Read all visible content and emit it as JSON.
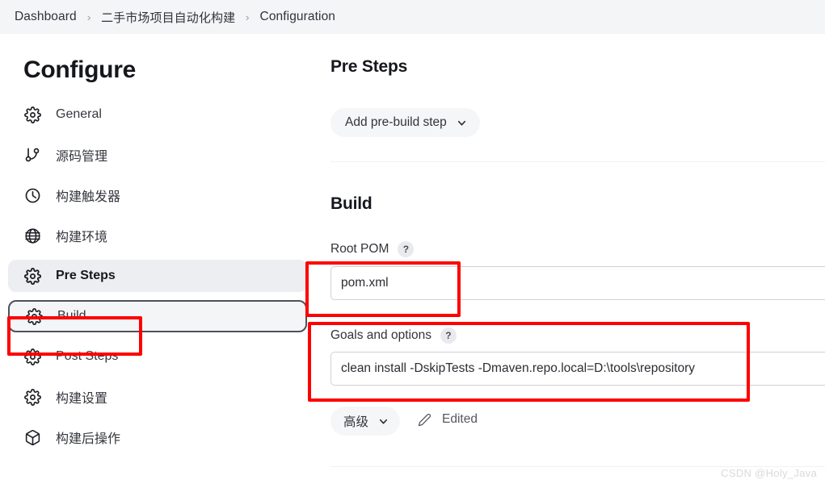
{
  "breadcrumb": {
    "separator": "›",
    "items": [
      {
        "label": "Dashboard",
        "lang": "en"
      },
      {
        "label": "二手市场项目自动化构建",
        "lang": "cn"
      },
      {
        "label": "Configuration",
        "lang": "en"
      }
    ]
  },
  "sidebar": {
    "title": "Configure",
    "items": [
      {
        "label": "General",
        "icon": "gear-icon",
        "state": "normal"
      },
      {
        "label": "源码管理",
        "icon": "git-branch-icon",
        "state": "normal"
      },
      {
        "label": "构建触发器",
        "icon": "clock-icon",
        "state": "normal"
      },
      {
        "label": "构建环境",
        "icon": "globe-icon",
        "state": "normal"
      },
      {
        "label": "Pre Steps",
        "icon": "gear-icon",
        "state": "active"
      },
      {
        "label": "Build",
        "icon": "gear-icon",
        "state": "focused"
      },
      {
        "label": "Post Steps",
        "icon": "gear-icon",
        "state": "normal"
      },
      {
        "label": "构建设置",
        "icon": "gear-icon",
        "state": "normal"
      },
      {
        "label": "构建后操作",
        "icon": "package-icon",
        "state": "normal"
      }
    ]
  },
  "main": {
    "pre_steps": {
      "title": "Pre Steps",
      "add_button_label": "Add pre-build step",
      "add_button_icon": "chevron-down-icon"
    },
    "build": {
      "title": "Build",
      "root_pom": {
        "label": "Root POM",
        "help": "?",
        "value": "pom.xml",
        "placeholder": ""
      },
      "goals": {
        "label": "Goals and options",
        "help": "?",
        "value": "clean install -DskipTests -Dmaven.repo.local=D:\\tools\\repository",
        "placeholder": ""
      },
      "advanced": {
        "label": "高级",
        "icon": "chevron-down-icon"
      },
      "edited": {
        "label": "Edited",
        "icon": "pencil-icon"
      }
    }
  },
  "annotations": {
    "color": "#fe0000",
    "boxes": [
      {
        "target": "sidebar-item-build"
      },
      {
        "target": "root-pom-input"
      },
      {
        "target": "goals-field-group"
      }
    ]
  },
  "watermark": {
    "text": "CSDN @Holy_Java"
  }
}
